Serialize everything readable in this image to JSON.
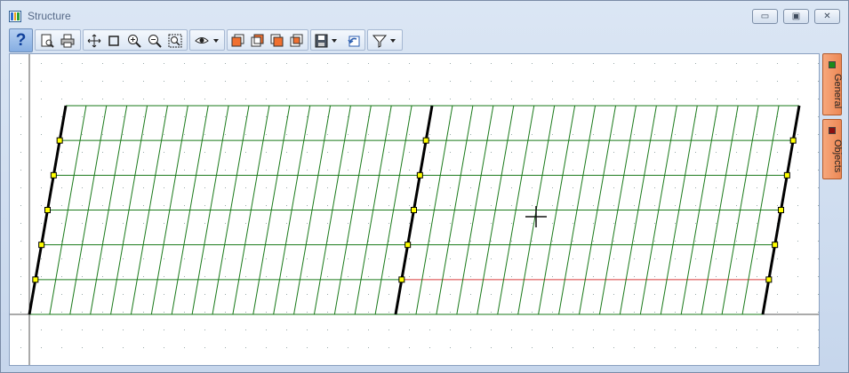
{
  "window": {
    "title": "Structure"
  },
  "title_buttons": {
    "minimize": "▭",
    "maximize": "▣",
    "close": "✕"
  },
  "toolbar": {
    "help": "?",
    "icons": [
      "help-icon",
      "print-preview-icon",
      "print-icon",
      "pan-icon",
      "select-rectangle-icon",
      "zoom-in-icon",
      "zoom-out-icon",
      "zoom-fit-icon",
      "view-eye-icon",
      "layer-1-icon",
      "layer-2-icon",
      "layer-3-icon",
      "layer-4-icon",
      "save-icon",
      "undo-view-icon",
      "filter-icon"
    ]
  },
  "side_tabs": [
    {
      "label": "General",
      "color": "#1a8a1a"
    },
    {
      "label": "Objects",
      "color": "#8b1010"
    }
  ],
  "colors": {
    "grid_line": "#1a7a1a",
    "selected_line": "#d83a3a",
    "node": "#ffff00",
    "boundary": "#000000"
  }
}
